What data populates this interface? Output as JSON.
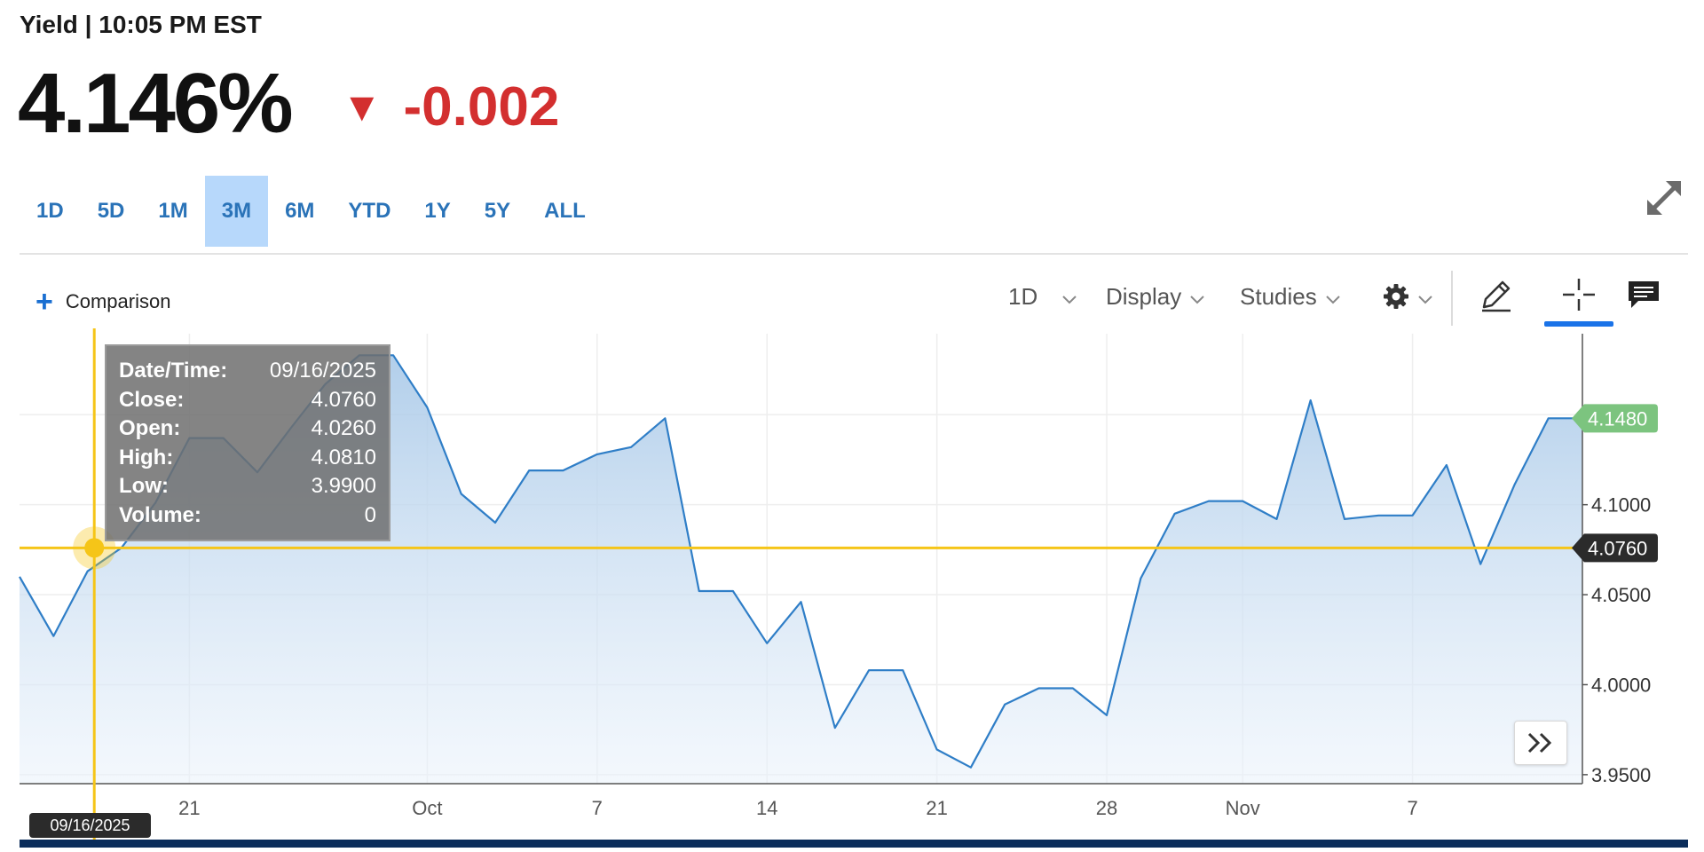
{
  "header": {
    "title": "Yield | 10:05 PM EST"
  },
  "quote": {
    "price": "4.146%",
    "change": "-0.002",
    "change_color": "#d32f2f"
  },
  "range_tabs": [
    {
      "label": "1D",
      "active": false
    },
    {
      "label": "5D",
      "active": false
    },
    {
      "label": "1M",
      "active": false
    },
    {
      "label": "3M",
      "active": true
    },
    {
      "label": "6M",
      "active": false
    },
    {
      "label": "YTD",
      "active": false
    },
    {
      "label": "1Y",
      "active": false
    },
    {
      "label": "5Y",
      "active": false
    },
    {
      "label": "ALL",
      "active": false
    }
  ],
  "toolbar": {
    "comparison_label": "Comparison",
    "interval_label": "1D",
    "display_label": "Display",
    "studies_label": "Studies",
    "icons": [
      "gear-icon",
      "pencil-icon",
      "crosshair-icon",
      "comment-icon",
      "expand-icon",
      "double-chevron-right-icon"
    ]
  },
  "tooltip": {
    "rows": [
      {
        "label": "Date/Time:",
        "value": "09/16/2025"
      },
      {
        "label": "Close:",
        "value": "4.0760"
      },
      {
        "label": "Open:",
        "value": "4.0260"
      },
      {
        "label": "High:",
        "value": "4.0810"
      },
      {
        "label": "Low:",
        "value": "3.9900"
      },
      {
        "label": "Volume:",
        "value": "0"
      }
    ]
  },
  "crosshair": {
    "date_label": "09/16/2025",
    "value_label": "4.0760",
    "value": 4.076
  },
  "last_value": {
    "label": "4.1480",
    "value": 4.148
  },
  "colors": {
    "line": "#2f7ec7",
    "crosshair": "#f5c518",
    "last_badge": "#7cc47f",
    "cross_badge": "#2b2b2b",
    "bottom_bar": "#0b2d5b"
  },
  "chart_data": {
    "type": "area",
    "series": [
      {
        "values": [
          4.06,
          4.027,
          4.063,
          4.076,
          4.101,
          4.137,
          4.137,
          4.118,
          4.143,
          4.167,
          4.183,
          4.183,
          4.154,
          4.106,
          4.09,
          4.119,
          4.119,
          4.128,
          4.132,
          4.148,
          4.052,
          4.052,
          4.023,
          4.046,
          3.976,
          4.008,
          4.008,
          3.964,
          3.954,
          3.989,
          3.998,
          3.998,
          3.983,
          4.059,
          4.095,
          4.102,
          4.102,
          4.092,
          4.158,
          4.092,
          4.094,
          4.094,
          4.122,
          4.067,
          4.111,
          4.148,
          4.148
        ]
      }
    ],
    "x_tick_labels": [
      {
        "label": "21",
        "index": 5
      },
      {
        "label": "Oct",
        "index": 12
      },
      {
        "label": "7",
        "index": 17
      },
      {
        "label": "14",
        "index": 22
      },
      {
        "label": "21",
        "index": 27
      },
      {
        "label": "28",
        "index": 32
      },
      {
        "label": "Nov",
        "index": 36
      },
      {
        "label": "7",
        "index": 41
      }
    ],
    "y_ticks": [
      3.95,
      4.0,
      4.05,
      4.1
    ],
    "y_tick_labels": [
      "3.9500",
      "4.0000",
      "4.0500",
      "4.1000"
    ],
    "ylim": [
      3.945,
      4.195
    ],
    "grid": true
  }
}
